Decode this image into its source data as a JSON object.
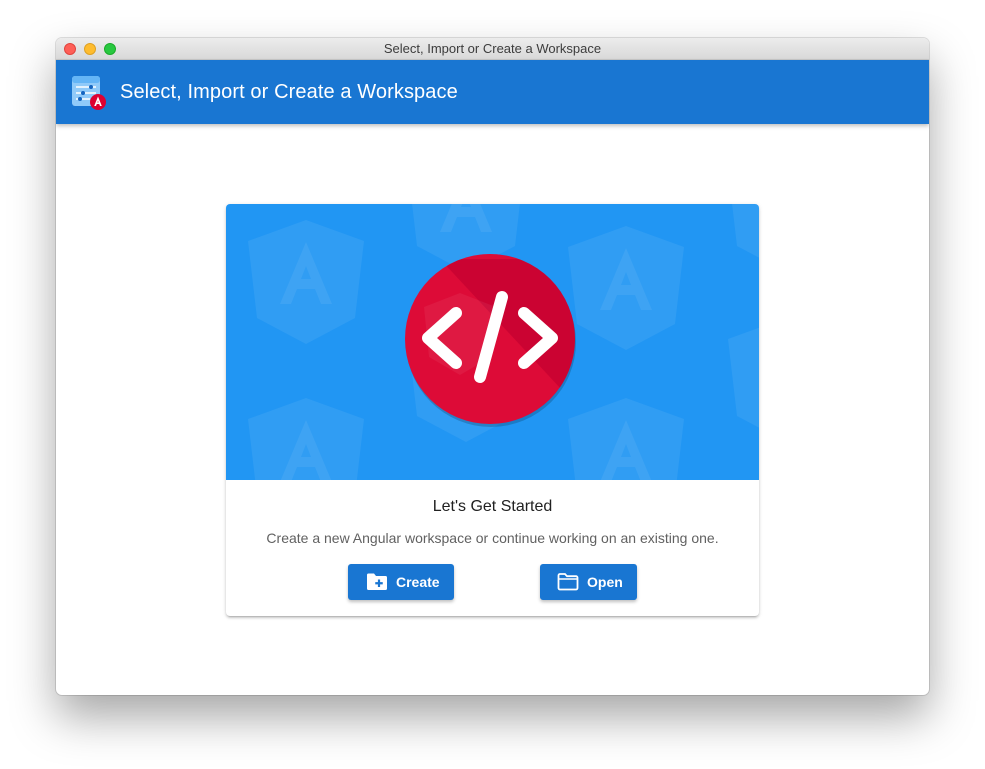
{
  "window": {
    "title": "Select, Import or Create a Workspace"
  },
  "appbar": {
    "title": "Select, Import or Create a Workspace",
    "logo_icon": "angular-workspace-icon"
  },
  "card": {
    "hero_icon": "code-brackets-icon",
    "title": "Let's Get Started",
    "subtitle": "Create a new Angular workspace or continue working on an existing one.",
    "create_label": "Create",
    "create_icon": "folder-plus-icon",
    "open_label": "Open",
    "open_icon": "folder-open-icon"
  },
  "colors": {
    "appbar": "#1976d2",
    "hero": "#2196f3",
    "badge": "#dd0031",
    "button": "#1976d2"
  }
}
